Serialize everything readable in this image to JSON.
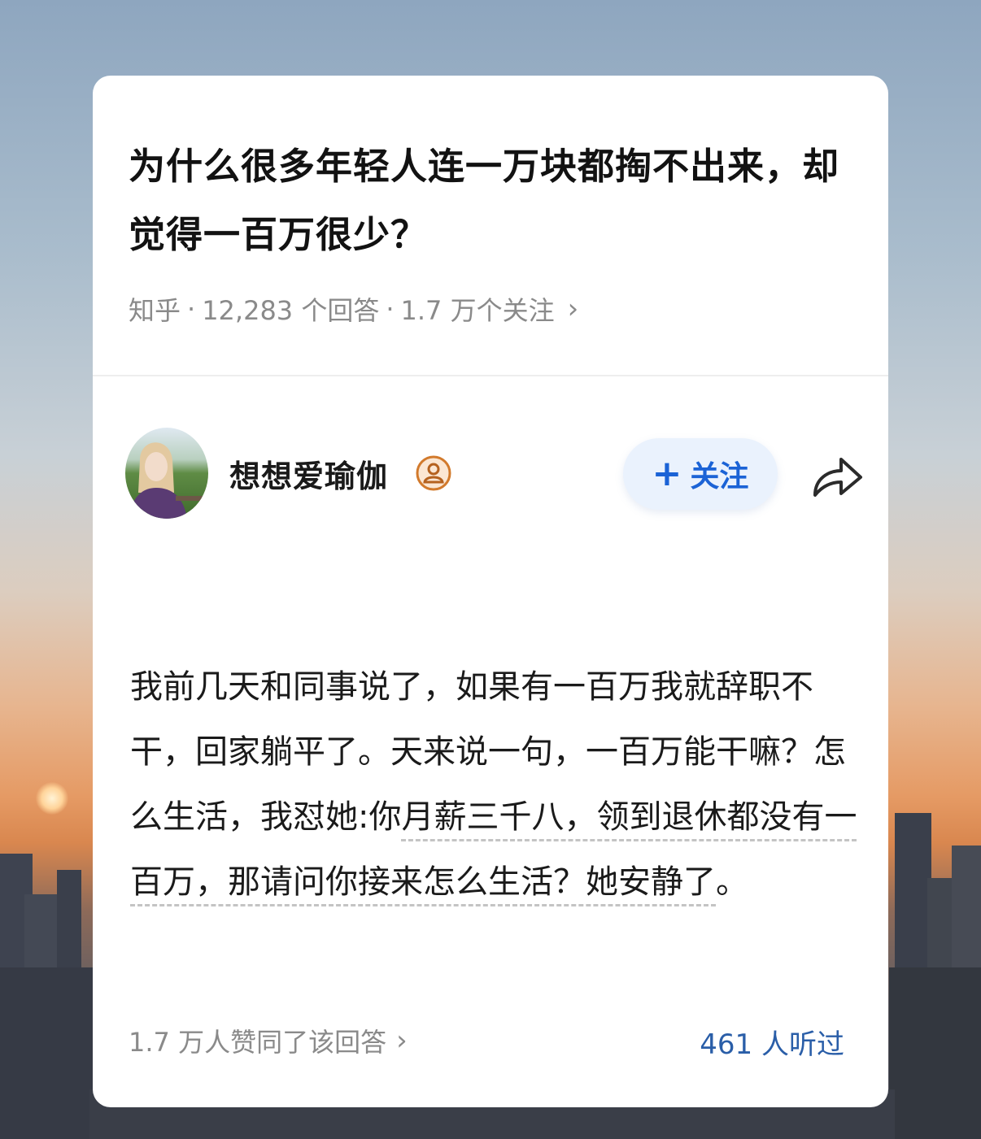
{
  "question": {
    "title": "为什么很多年轻人连一万块都掏不出来，却觉得一百万很少？",
    "meta": {
      "source": "知乎",
      "sep": "·",
      "answers": "12,283 个回答",
      "follows": "1.7 万个关注",
      "chevron": "›"
    }
  },
  "author": {
    "name": "想想爱瑜伽",
    "badge_icon": "verified-user-icon",
    "follow_label": "关注",
    "follow_plus": "+",
    "share_icon": "share-icon"
  },
  "answer": {
    "part1": "我前几天和同事说了，如果有一百万我就辞职不干，回家躺平了。天来说一句，一百万能干嘛？怎么生活，我怼她:你",
    "part2": "月薪三千八，领到退休都没有一百万，那请问你接来怎么生活？她安静了",
    "part3": "。"
  },
  "footer": {
    "likes": "1.7 万人赞同了该回答",
    "chevron": "›",
    "listened": "461 人听过"
  },
  "colors": {
    "accent": "#1b63d6",
    "follow_bg": "#eaf2fd",
    "meta_gray": "#8a8a8a",
    "link_blue": "#2a5ea8"
  }
}
